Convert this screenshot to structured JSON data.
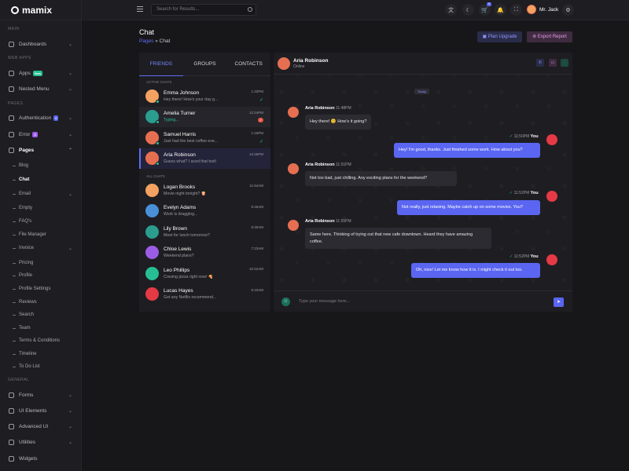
{
  "app": {
    "name": "mamix"
  },
  "sidebar": {
    "sections": {
      "main": "MAIN",
      "web_apps": "WEB APPS",
      "pages": "PAGES",
      "general": "GENERAL"
    },
    "items": {
      "dashboards": "Dashboards",
      "apps": "Apps",
      "apps_badge": "New",
      "nested_menu": "Nested Menu",
      "authentication": "Authentication",
      "auth_badge": "6",
      "error": "Error",
      "error_badge": "3",
      "pages": "Pages",
      "forms": "Forms",
      "ui_elements": "UI Elements",
      "advanced_ui": "Advanced UI",
      "utilities": "Utilities",
      "widgets": "Widgets"
    },
    "subitems": [
      "Blog",
      "Chat",
      "Email",
      "Empty",
      "FAQ's",
      "File Manager",
      "Invoice",
      "Pricing",
      "Profile",
      "Profile Settings",
      "Reviews",
      "Search",
      "Team",
      "Terms & Conditions",
      "Timeline",
      "To Do List"
    ]
  },
  "header": {
    "search_placeholder": "Search for Results...",
    "cart_badge": "5",
    "user_name": "Mr. Jack"
  },
  "page": {
    "title": "Chat",
    "breadcrumb_parent": "Pages",
    "breadcrumb_current": "Chat",
    "btn_upgrade": "Plan Upgrade",
    "btn_export": "Export Report"
  },
  "chat_list": {
    "tabs": [
      "FRIENDS",
      "GROUPS",
      "CONTACTS"
    ],
    "active_label": "ACTIVE CHATS",
    "all_label": "ALL CHATS",
    "active": [
      {
        "name": "Emma Johnson",
        "msg": "Hey there! How's your day g...",
        "time": "1:32PM"
      },
      {
        "name": "Amelia Turner",
        "msg": "Typing...",
        "time": "12:24PM",
        "count": "2"
      },
      {
        "name": "Samuel Harris",
        "msg": "Just had the best coffee eve...",
        "time": "1:16PM"
      },
      {
        "name": "Aria Robinson",
        "msg": "Guess what? I aced that test!",
        "time": "12:45PM"
      }
    ],
    "all": [
      {
        "name": "Logan Brooks",
        "msg": "Movie night tonight? 🍿",
        "time": "11:54AM"
      },
      {
        "name": "Evelyn Adams",
        "msg": "Work is dragging...",
        "time": "9:45AM"
      },
      {
        "name": "Lily Brown",
        "msg": "Meet for lunch tomorrow?",
        "time": "8:30AM"
      },
      {
        "name": "Chloe Lewis",
        "msg": "Weekend plans?",
        "time": "7:23AM"
      },
      {
        "name": "Leo Phillips",
        "msg": "Craving pizza right now! 🍕",
        "time": "10:22AM"
      },
      {
        "name": "Lucas Hayes",
        "msg": "Got any Netflix recommend...",
        "time": "9:10AM"
      }
    ]
  },
  "conversation": {
    "contact_name": "Aria Robinson",
    "contact_status": "Online",
    "day_label": "Today",
    "you_label": "You",
    "messages": [
      {
        "sender": "Aria Robinson",
        "time": "11:48PM",
        "text": "Hey there! 😊 How's it going?"
      },
      {
        "sender": "You",
        "time": "11:50PM",
        "text": "Hey! I'm good, thanks. Just finished some work. How about you?"
      },
      {
        "sender": "Aria Robinson",
        "time": "11:51PM",
        "text": "Not too bad, just chilling. Any exciting plans for the weekend?"
      },
      {
        "sender": "You",
        "time": "11:52PM",
        "text": "Not really, just relaxing. Maybe catch up on some movies. You?"
      },
      {
        "sender": "Aria Robinson",
        "time": "11:55PM",
        "text": "Same here. Thinking of trying out that new cafe downtown. Heard they have amazing coffee."
      },
      {
        "sender": "You",
        "time": "11:52PM",
        "text": "Oh, nice! Let me know how it is. I might check it out too."
      }
    ],
    "input_placeholder": "Type your message here..."
  },
  "colors": {
    "accent": "#5a66f1",
    "online": "#26bf94",
    "danger": "#e6533c"
  }
}
